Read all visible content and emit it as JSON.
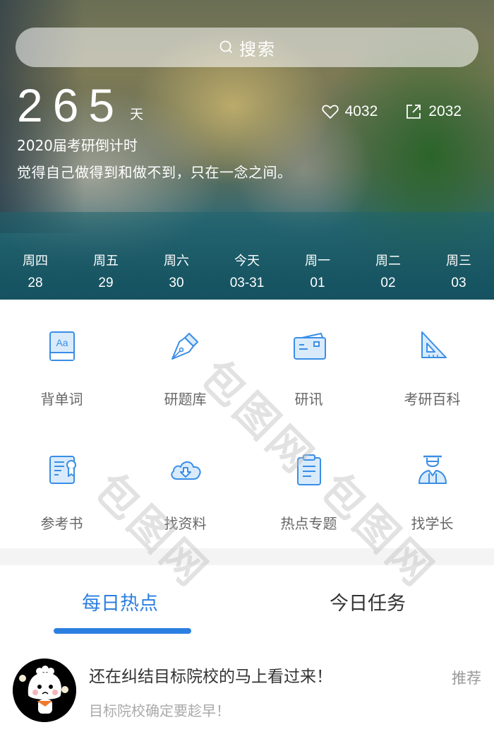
{
  "search": {
    "label": "搜索",
    "icon": "search-icon"
  },
  "countdown": {
    "days": "265",
    "unit": "天",
    "subtitle": "2020届考研倒计时",
    "motto": "觉得自己做得到和做不到，只在一念之间。"
  },
  "stats": {
    "likes": {
      "icon": "heart-icon",
      "value": "4032"
    },
    "shares": {
      "icon": "share-icon",
      "value": "2032"
    }
  },
  "week": [
    {
      "weekday": "周四",
      "date": "28"
    },
    {
      "weekday": "周五",
      "date": "29"
    },
    {
      "weekday": "周六",
      "date": "30"
    },
    {
      "weekday": "今天",
      "date": "03-31",
      "today": true
    },
    {
      "weekday": "周一",
      "date": "01"
    },
    {
      "weekday": "周二",
      "date": "02"
    },
    {
      "weekday": "周三",
      "date": "03"
    }
  ],
  "features": [
    {
      "label": "背单词",
      "icon": "vocabulary-book-icon"
    },
    {
      "label": "研题库",
      "icon": "fountain-pen-icon"
    },
    {
      "label": "研讯",
      "icon": "news-card-icon"
    },
    {
      "label": "考研百科",
      "icon": "set-square-icon"
    },
    {
      "label": "参考书",
      "icon": "certificate-book-icon"
    },
    {
      "label": "找资料",
      "icon": "cloud-download-icon"
    },
    {
      "label": "热点专题",
      "icon": "clipboard-icon"
    },
    {
      "label": "找学长",
      "icon": "graduate-icon"
    }
  ],
  "watermark": "包图网",
  "tabs": [
    {
      "label": "每日热点",
      "active": true
    },
    {
      "label": "今日任务",
      "active": false
    }
  ],
  "feed": [
    {
      "title": "还在纠结目标院校的马上看过来！",
      "description": "目标院校确定要趁早！",
      "tag": "推荐",
      "avatar": "cartoon-bun-avatar"
    }
  ],
  "colors": {
    "accent": "#2b7fe0",
    "icon_stroke": "#3a8ee6",
    "icon_fill": "#d9ebfb",
    "label": "#666666"
  }
}
